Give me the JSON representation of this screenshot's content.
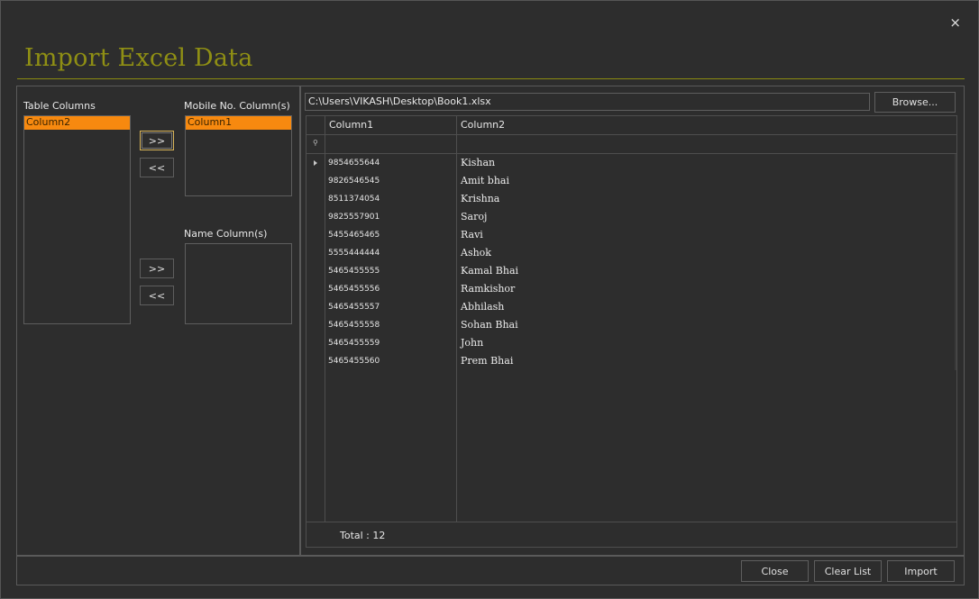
{
  "window": {
    "title": "Import Excel Data",
    "close_glyph": "×",
    "accent_color": "#8f8f14",
    "selection_color": "#f7890f"
  },
  "left": {
    "table_columns_label": "Table Columns",
    "table_columns": [
      "Column2"
    ],
    "mobile_label": "Mobile No. Column(s)",
    "mobile_columns": [
      "Column1"
    ],
    "name_label": "Name Column(s)",
    "name_columns": [],
    "move_right": ">>",
    "move_left": "<<"
  },
  "right": {
    "file_path": "C:\\Users\\VIKASH\\Desktop\\Book1.xlsx",
    "browse_label": "Browse...",
    "grid": {
      "columns": [
        "Column1",
        "Column2"
      ],
      "rows": [
        [
          "9854655644",
          "Kishan"
        ],
        [
          "9826546545",
          "Amit bhai"
        ],
        [
          "8511374054",
          "Krishna"
        ],
        [
          "9825557901",
          "Saroj"
        ],
        [
          "5455465465",
          "Ravi"
        ],
        [
          "5555444444",
          "Ashok"
        ],
        [
          "5465455555",
          "Kamal Bhai"
        ],
        [
          "5465455556",
          "Ramkishor"
        ],
        [
          "5465455557",
          "Abhilash"
        ],
        [
          "5465455558",
          "Sohan Bhai"
        ],
        [
          "5465455559",
          "John"
        ],
        [
          "5465455560",
          "Prem Bhai"
        ]
      ],
      "total_text": "Total : 12"
    }
  },
  "footer": {
    "close_label": "Close",
    "clear_list_label": "Clear List",
    "import_label": "Import"
  }
}
